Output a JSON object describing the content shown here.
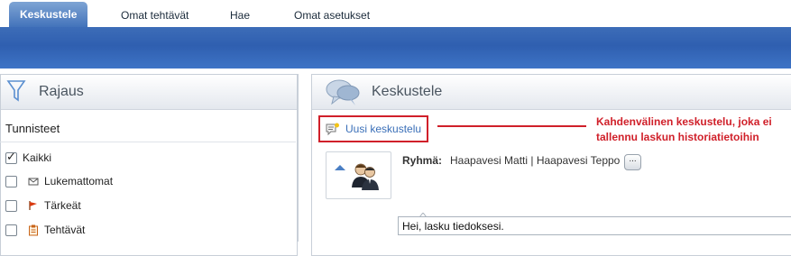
{
  "nav": {
    "tabs": [
      {
        "label": "Keskustele",
        "active": true
      },
      {
        "label": "Omat tehtävät",
        "active": false
      },
      {
        "label": "Hae",
        "active": false
      },
      {
        "label": "Omat asetukset",
        "active": false
      }
    ]
  },
  "left_panel": {
    "title": "Rajaus",
    "section_title": "Tunnisteet",
    "filters": [
      {
        "label": "Kaikki",
        "checked": true,
        "icon": "none"
      },
      {
        "label": "Lukemattomat",
        "checked": false,
        "icon": "envelope-icon"
      },
      {
        "label": "Tärkeät",
        "checked": false,
        "icon": "flag-icon"
      },
      {
        "label": "Tehtävät",
        "checked": false,
        "icon": "task-icon"
      }
    ]
  },
  "right_panel": {
    "title": "Keskustele",
    "new_conversation_label": "Uusi keskustelu",
    "group_label": "Ryhmä:",
    "group_members": "Haapavesi Matti | Haapavesi Teppo",
    "more_button_label": "...",
    "message_preview": "Hei, lasku tiedoksesi."
  },
  "annotation": {
    "text": "Kahdenvälinen keskustelu, joka ei tallennu laskun historiatietoihin"
  },
  "colors": {
    "banner": "#2f5fb0",
    "highlight_red": "#d0202a",
    "link_blue": "#3a6fb8"
  }
}
